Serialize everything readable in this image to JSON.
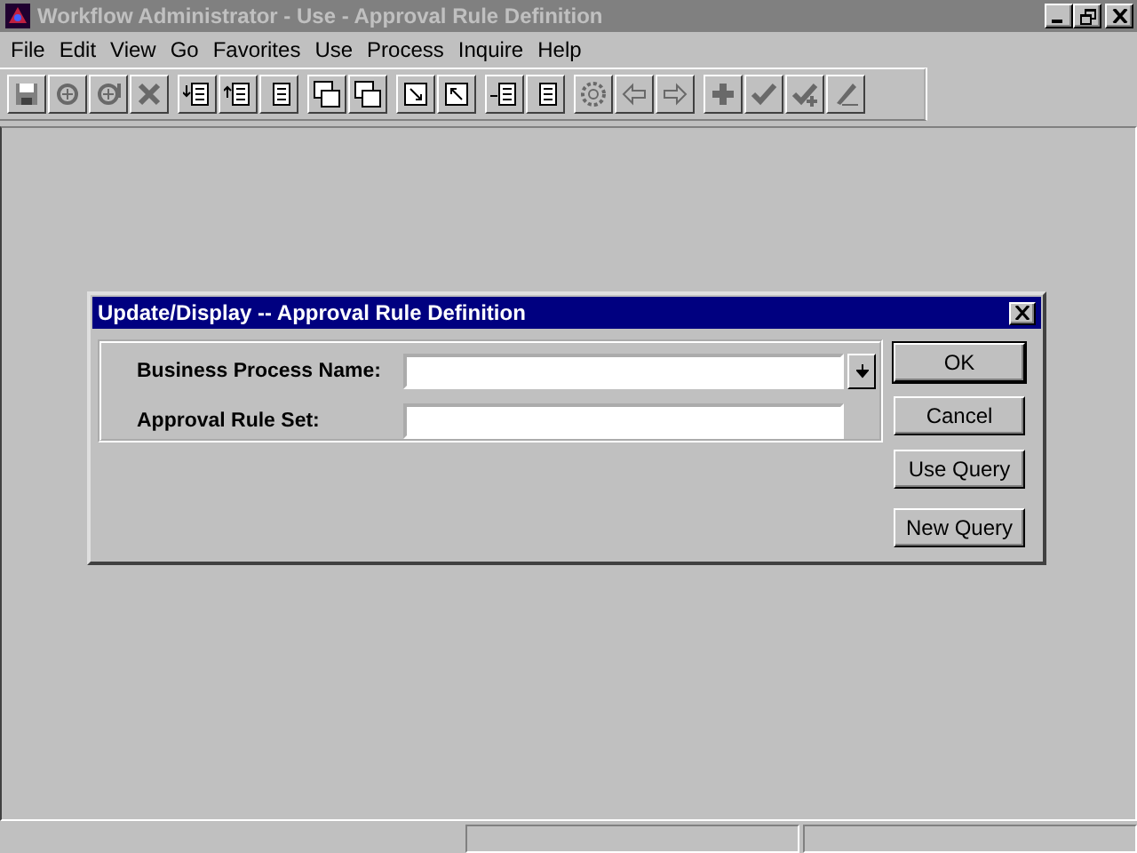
{
  "window": {
    "title": "Workflow Administrator - Use - Approval Rule Definition"
  },
  "menu": [
    "File",
    "Edit",
    "View",
    "Go",
    "Favorites",
    "Use",
    "Process",
    "Inquire",
    "Help"
  ],
  "toolbar": [
    [
      {
        "kind": "save",
        "disabled": false
      },
      {
        "kind": "stamp",
        "disabled": true
      },
      {
        "kind": "stamp-bang",
        "disabled": true
      },
      {
        "kind": "delete",
        "disabled": true
      }
    ],
    [
      {
        "kind": "list-down",
        "disabled": false
      },
      {
        "kind": "list-up",
        "disabled": false
      },
      {
        "kind": "list",
        "disabled": false
      }
    ],
    [
      {
        "kind": "windows",
        "disabled": false
      },
      {
        "kind": "windows",
        "disabled": false
      }
    ],
    [
      {
        "kind": "box-in",
        "disabled": false
      },
      {
        "kind": "box-out",
        "disabled": false
      }
    ],
    [
      {
        "kind": "list-in",
        "disabled": false
      },
      {
        "kind": "form",
        "disabled": false
      }
    ],
    [
      {
        "kind": "gear",
        "disabled": true
      },
      {
        "kind": "left",
        "disabled": true
      },
      {
        "kind": "right",
        "disabled": true
      }
    ],
    [
      {
        "kind": "plus",
        "disabled": true
      },
      {
        "kind": "check",
        "disabled": true
      },
      {
        "kind": "check-plus",
        "disabled": true
      },
      {
        "kind": "pencil",
        "disabled": true
      }
    ]
  ],
  "dialog": {
    "title": "Update/Display -- Approval Rule Definition",
    "fields": [
      {
        "label": "Business Process Name:",
        "kind": "dropdown"
      },
      {
        "label": "Approval Rule Set:",
        "kind": "text"
      }
    ],
    "buttons": [
      "OK",
      "Cancel",
      "Use Query",
      "New Query"
    ]
  }
}
